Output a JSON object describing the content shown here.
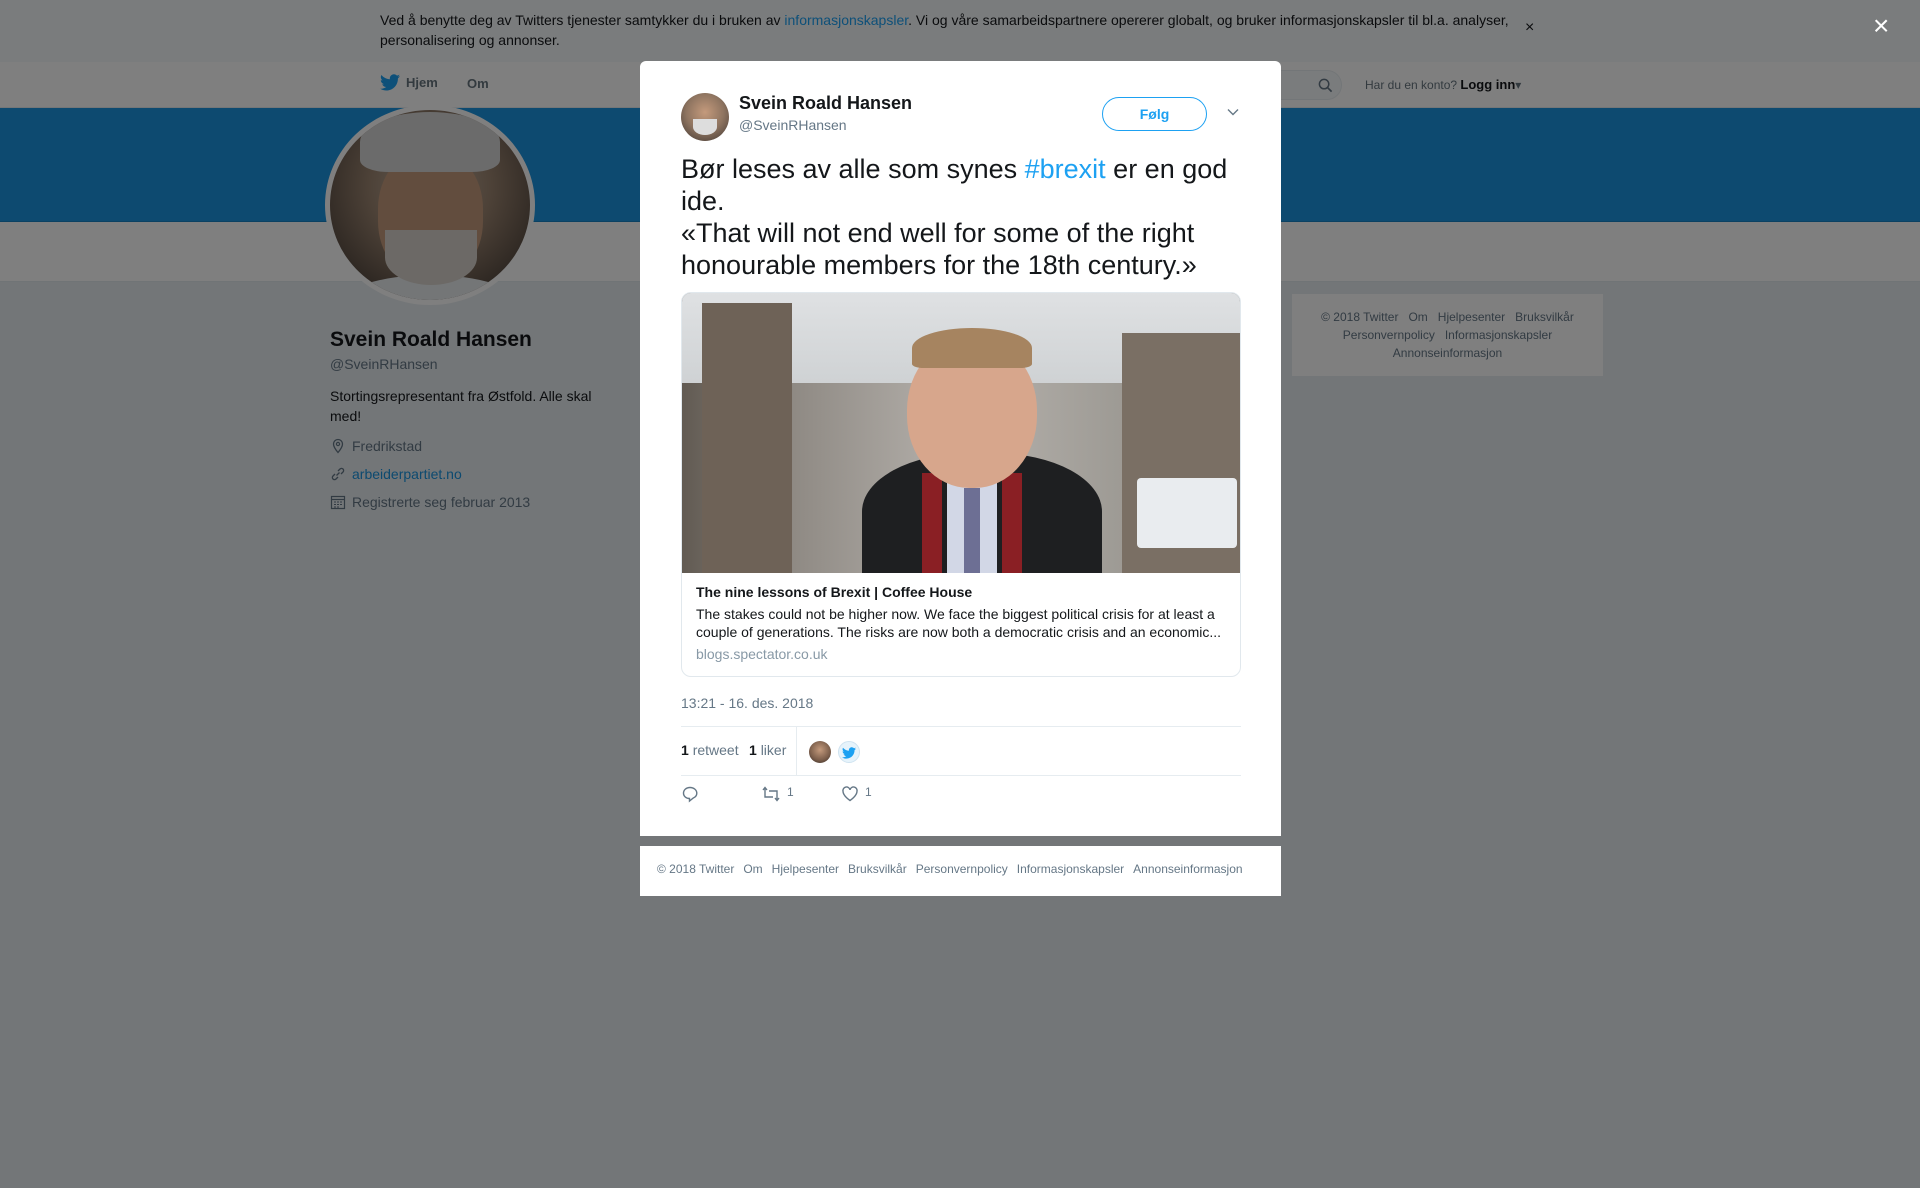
{
  "cookie": {
    "text_before": "Ved å benytte deg av Twitters tjenester samtykker du i bruken av ",
    "link": "informasjonskapsler",
    "text_after": ". Vi og våre samarbeidspartnere opererer globalt, og bruker informasjonskapsler til bl.a. analyser, personalisering og annonser.",
    "close": "×"
  },
  "nav": {
    "home": "Hjem",
    "about": "Om",
    "login_prompt": "Har du en konto?",
    "login": "Logg inn"
  },
  "profile": {
    "name": "Svein Roald Hansen",
    "handle": "@SveinRHansen",
    "bio": "Stortingsrepresentant fra Østfold. Alle skal med!",
    "location": "Fredrikstad",
    "website": "arbeiderpartiet.no",
    "joined": "Registrerte seg februar 2013"
  },
  "side_footer": {
    "items": [
      "© 2018 Twitter",
      "Om",
      "Hjelpesenter",
      "Bruksvilkår",
      "Personvernpolicy",
      "Informasjonskapsler",
      "Annonseinformasjon"
    ]
  },
  "overlay_close": "×",
  "tweet": {
    "name": "Svein Roald Hansen",
    "handle": "@SveinRHansen",
    "follow": "Følg",
    "text_before": "Bør leses av alle som synes ",
    "hashtag": "#brexit",
    "text_after": " er en god ide.\n«That will not end well for some of the right honourable members for the 18th century.»",
    "card": {
      "title": "The nine lessons of Brexit | Coffee House",
      "description": "The stakes could not be higher now. We face the biggest political crisis for at least a couple of generations. The risks are now both a democratic crisis and an economic...",
      "url": "blogs.spectator.co.uk"
    },
    "timestamp": "13:21 - 16. des. 2018",
    "retweets_count": "1",
    "retweets_label": "retweet",
    "likes_count": "1",
    "likes_label": "liker",
    "reply_count": "",
    "retweet_action_count": "1",
    "like_action_count": "1"
  },
  "modal_footer": {
    "items": [
      "© 2018 Twitter",
      "Om",
      "Hjelpesenter",
      "Bruksvilkår",
      "Personvernpolicy",
      "Informasjonskapsler",
      "Annonseinformasjon"
    ]
  },
  "colors": {
    "brand_blue": "#1da1f2",
    "banner_blue": "#1b95e0",
    "overlay": "rgba(0,0,0,0.5)"
  },
  "icons": [
    "twitter-bird-icon",
    "search-icon",
    "location-icon",
    "link-icon",
    "calendar-icon",
    "chevron-down-icon",
    "reply-icon",
    "retweet-icon",
    "heart-icon",
    "close-icon"
  ]
}
